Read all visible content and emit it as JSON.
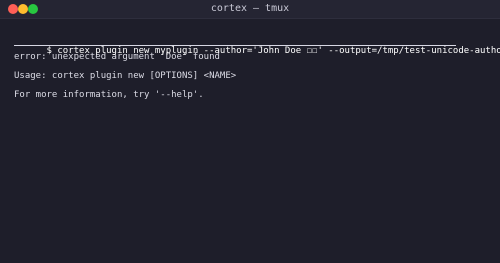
{
  "window": {
    "title": "cortex — tmux"
  },
  "terminal": {
    "command_line": "$ cortex plugin new myplugin --author='John Doe ☐☐' --output=/tmp/test-unicode-author",
    "error_line": "error: unexpected argument 'Doe' found",
    "usage_line": "Usage: cortex plugin new [OPTIONS] <NAME>",
    "help_line": "For more information, try '--help'."
  },
  "colors": {
    "close": "#ff5f57",
    "minimize": "#febc2e",
    "zoom": "#28c840",
    "background": "#1e1e2a"
  }
}
